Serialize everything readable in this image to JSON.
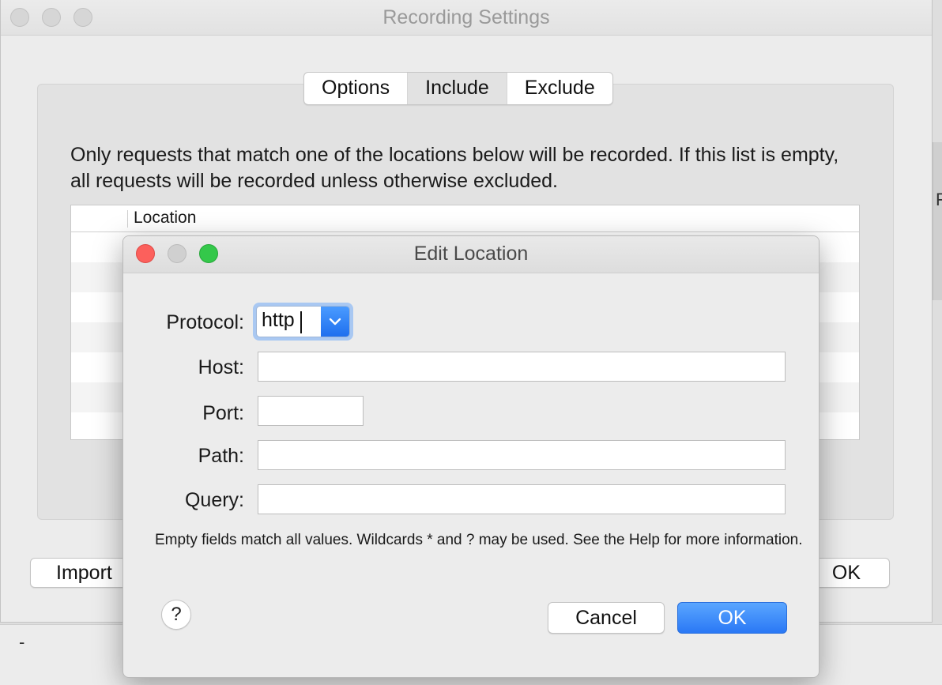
{
  "main_window": {
    "title": "Recording Settings",
    "tabs": [
      {
        "label": "Options",
        "selected": false
      },
      {
        "label": "Include",
        "selected": true
      },
      {
        "label": "Exclude",
        "selected": false
      }
    ],
    "description": "Only requests that match one of the locations below will be recorded. If this list is empty, all requests will be recorded unless otherwise excluded.",
    "table": {
      "columns": [
        "Location"
      ]
    },
    "buttons": {
      "import_label": "Import",
      "ok_label": "OK"
    }
  },
  "dialog": {
    "title": "Edit Location",
    "protocol": {
      "label": "Protocol:",
      "value": "http"
    },
    "host": {
      "label": "Host:",
      "value": ""
    },
    "port": {
      "label": "Port:",
      "value": ""
    },
    "path": {
      "label": "Path:",
      "value": ""
    },
    "query": {
      "label": "Query:",
      "value": ""
    },
    "hint": "Empty fields match all values. Wildcards * and ? may be used. See the Help for more information.",
    "help_label": "?",
    "cancel_label": "Cancel",
    "ok_label": "OK"
  },
  "background": {
    "edge_letter": "F",
    "bottom_dash": "-"
  },
  "colors": {
    "accent": "#2a78f5",
    "close": "#fc605c",
    "zoom": "#34c84a"
  }
}
